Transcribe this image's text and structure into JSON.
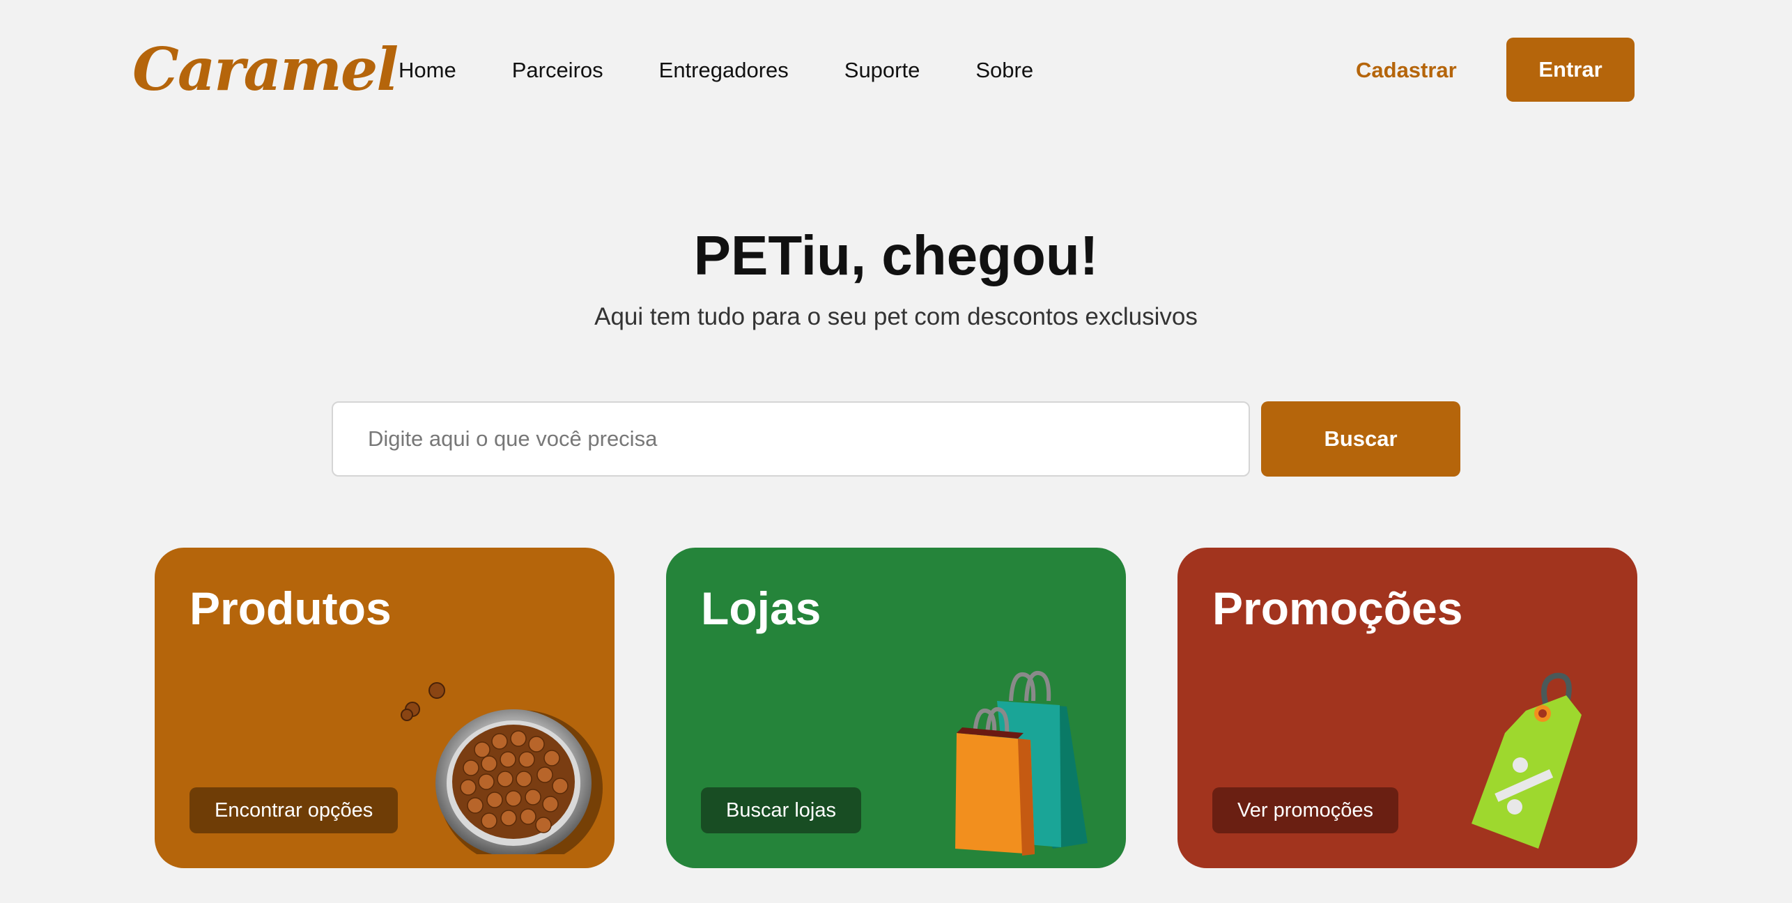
{
  "header": {
    "logo": "Caramel",
    "nav": [
      "Home",
      "Parceiros",
      "Entregadores",
      "Suporte",
      "Sobre"
    ],
    "signup_label": "Cadastrar",
    "login_label": "Entrar"
  },
  "hero": {
    "title": "PETiu, chegou!",
    "subtitle": "Aqui tem tudo para o seu pet com descontos exclusivos"
  },
  "search": {
    "placeholder": "Digite aqui o que você precisa",
    "button_label": "Buscar"
  },
  "cards": [
    {
      "title": "Produtos",
      "button_label": "Encontrar opções",
      "color": "#b5650b",
      "icon": "pet-food-bowl-icon"
    },
    {
      "title": "Lojas",
      "button_label": "Buscar lojas",
      "color": "#25843a",
      "icon": "shopping-bags-icon"
    },
    {
      "title": "Promoções",
      "button_label": "Ver promoções",
      "color": "#a2341e",
      "icon": "discount-tag-icon"
    }
  ],
  "colors": {
    "accent": "#b5650b",
    "background": "#f2f2f2"
  }
}
